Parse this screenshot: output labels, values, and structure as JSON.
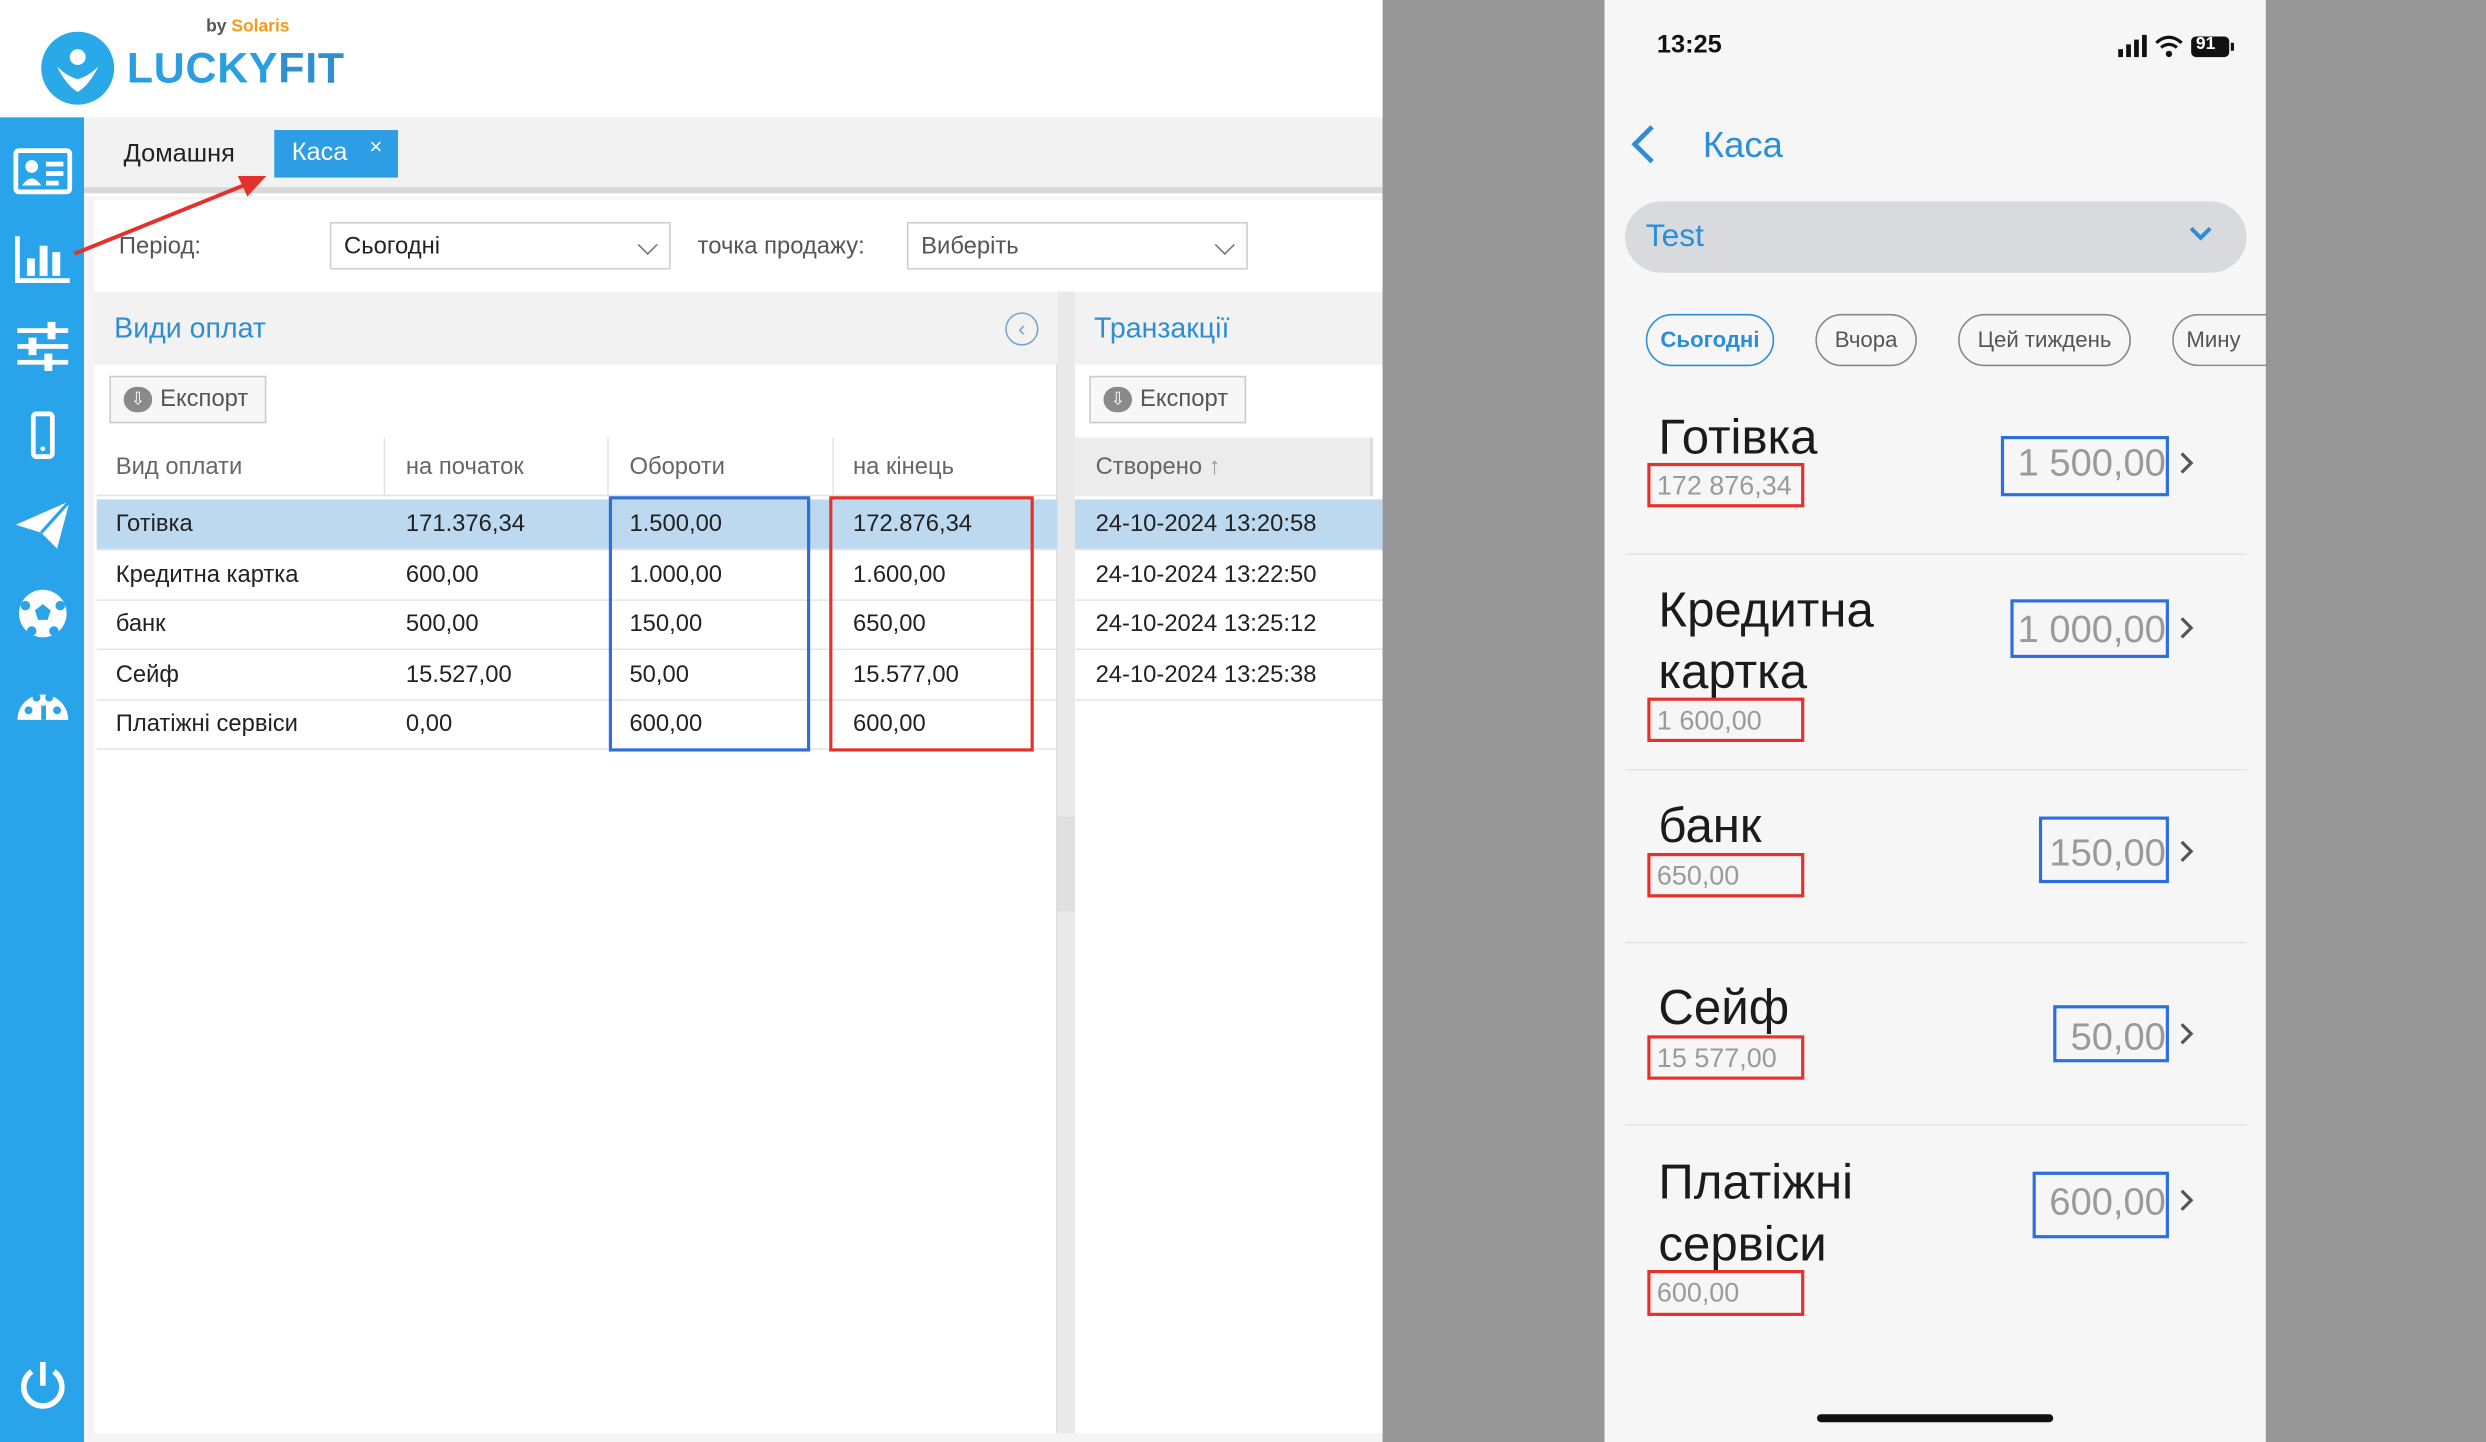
{
  "brand": {
    "by_label": "by",
    "by_brand": "Solaris",
    "name_lucky": "LUCKY",
    "name_fit": "FIT"
  },
  "sidebar": {
    "items": [
      "clients-icon",
      "reports-icon",
      "settings-sliders-icon",
      "mobile-icon",
      "send-icon",
      "sport-ball-icon",
      "palette-icon"
    ],
    "bottom": "power-icon"
  },
  "tabs": {
    "home": "Домашня",
    "kasa": "Каса",
    "close": "×"
  },
  "filter": {
    "period_label": "Період:",
    "period_value": "Сьогодні",
    "point_label": "точка продажу:",
    "point_placeholder": "Виберіть"
  },
  "payments_panel": {
    "title": "Види оплат",
    "export_label": "Експорт",
    "columns": [
      "Вид оплати",
      "на початок",
      "Обороти",
      "на кінець"
    ],
    "rows": [
      [
        "Готівка",
        "171.376,34",
        "1.500,00",
        "172.876,34"
      ],
      [
        "Кредитна картка",
        "600,00",
        "1.000,00",
        "1.600,00"
      ],
      [
        "банк",
        "500,00",
        "150,00",
        "650,00"
      ],
      [
        "Сейф",
        "15.527,00",
        "50,00",
        "15.577,00"
      ],
      [
        "Платіжні сервіси",
        "0,00",
        "600,00",
        "600,00"
      ]
    ]
  },
  "transactions_panel": {
    "title": "Транзакції",
    "export_label": "Експорт",
    "column": "Створено",
    "sort_icon": "↑",
    "rows": [
      "24-10-2024 13:20:58",
      "24-10-2024 13:22:50",
      "24-10-2024 13:25:12",
      "24-10-2024 13:25:38"
    ]
  },
  "phone": {
    "time": "13:25",
    "battery": "91",
    "title": "Каса",
    "select_value": "Test",
    "chips": [
      "Сьогодні",
      "Вчора",
      "Цей тиждень",
      "Мину"
    ],
    "rows": [
      {
        "name": "Готівка",
        "sub": "172 876,34",
        "value": "1 500,00"
      },
      {
        "name": "Кредитна картка",
        "sub": "1 600,00",
        "value": "1 000,00"
      },
      {
        "name": "банк",
        "sub": "650,00",
        "value": "150,00"
      },
      {
        "name": "Сейф",
        "sub": "15 577,00",
        "value": "50,00"
      },
      {
        "name": "Платіжні сервіси",
        "sub": "600,00",
        "value": "600,00"
      }
    ]
  },
  "colors": {
    "accent": "#29a3ea",
    "highlight_blue": "#2e6fe0",
    "highlight_red": "#e5312b",
    "selected_row": "#bcd9f0"
  }
}
